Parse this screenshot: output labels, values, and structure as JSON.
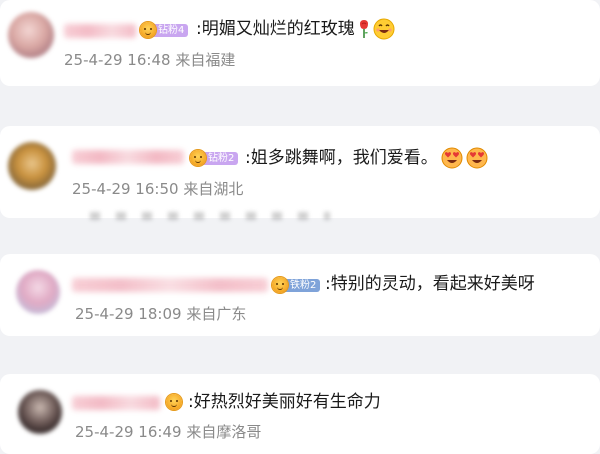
{
  "comments": [
    {
      "badge": "钻粉4",
      "text": ":明媚又灿烂的红玫瑰",
      "emojis": [
        "rose-icon",
        "smiling-face-icon"
      ],
      "timestamp": "25-4-29 16:48",
      "location": "来自福建"
    },
    {
      "badge": "钻粉2",
      "text": ":姐多跳舞啊，我们爱看。",
      "emojis": [
        "heart-eyes-icon",
        "heart-eyes-icon"
      ],
      "timestamp": "25-4-29 16:50",
      "location": "来自湖北"
    },
    {
      "badge": "铁粉2",
      "text": ":特别的灵动，看起来好美呀",
      "emojis": [],
      "timestamp": "25-4-29 18:09",
      "location": "来自广东"
    },
    {
      "badge": "",
      "text": ":好热烈好美丽好有生命力",
      "emojis": [],
      "timestamp": "25-4-29 16:49",
      "location": "来自摩洛哥"
    }
  ]
}
